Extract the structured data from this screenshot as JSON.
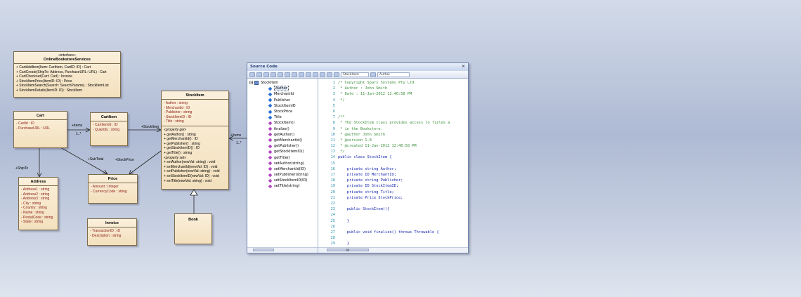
{
  "diagram": {
    "interface": {
      "stereotype": "«interface»",
      "name": "OnlineBookstoreServices",
      "ops": [
        "+  CartAddItem(Item: CartItem, CartID: ID)  : Cart",
        "+  CartCreate(ShipTo: Address, PurchaseURL: URL)  : Cart",
        "+  CartCheckout(Cart: Cart)  : Invoice",
        "+  StockItemPrice(ItemID: ID)  : Price",
        "+  StockItemSearch(Search: SearchParams)  : StockItemList",
        "+  StockItemDetails(ItemID: ID)  : StockItem"
      ]
    },
    "cart": {
      "name": "Cart",
      "attrs": [
        "-  CartId  : ID",
        "-  PurchaseURL  : URL"
      ]
    },
    "cartitem": {
      "name": "CartItem",
      "attrs": [
        "-  CartItemId  : ID",
        "-  Quantity  : string"
      ]
    },
    "stockitem": {
      "name": "StockItem",
      "attrs": [
        "-  Author  : string",
        "-  MerchantId  : ID",
        "-  Publisher  : string",
        "-  StockItemID  : ID",
        "-  Title  : string"
      ],
      "get_group": "«property get»",
      "gets": [
        "+  getAuthor()  : string",
        "+  getMerchantId()  : ID",
        "+  getPublisher()  : string",
        "+  getStockItemID()  : ID",
        "+  getTitle()  : string"
      ],
      "set_group": "«property set»",
      "sets": [
        "+  setAuthor(newVal: string)  : void",
        "+  setMerchantId(newVal: ID)  : void",
        "+  setPublisher(newVal: string)  : void",
        "+  setStockItemID(newVal: ID)  : void",
        "+  setTitle(newVal: string)  : void"
      ]
    },
    "address": {
      "name": "Address",
      "attrs": [
        "-  Address1  : string",
        "-  Address2  : string",
        "-  Address3  : string",
        "-  City  : string",
        "-  Country  : string",
        "-  Name  : string",
        "-  PostalCode  : string",
        "-  State  : string"
      ]
    },
    "price": {
      "name": "Price",
      "attrs": [
        "-  Amount  : Integer",
        "-  CurrencyCode  : string"
      ]
    },
    "invoice": {
      "name": "Invoice",
      "attrs": [
        "-  TransactionID  : ID",
        "-  Description  : string"
      ]
    },
    "book": {
      "name": "Book"
    },
    "labels": {
      "items1": "+Items",
      "mult1": "1..*",
      "stockitem": "+StockItem",
      "items2": "+Items",
      "mult2": "1..*",
      "subtotal": "+SubTotal",
      "stockprice": "+StockPrice",
      "shipto": "+ShipTo"
    }
  },
  "source_window": {
    "title": "Source Code",
    "close": "×",
    "toolbar_field_1": "StockItem",
    "toolbar_field_2": "Author",
    "tree": {
      "root": "StockItem",
      "items": [
        {
          "label": "Author",
          "kind": "attr"
        },
        {
          "label": "MerchantId",
          "kind": "attr"
        },
        {
          "label": "Publisher",
          "kind": "attr"
        },
        {
          "label": "StockItemID",
          "kind": "attr"
        },
        {
          "label": "StockPrice",
          "kind": "attr"
        },
        {
          "label": "Title",
          "kind": "attr"
        },
        {
          "label": "StockItem()",
          "kind": "op"
        },
        {
          "label": "finalize()",
          "kind": "op"
        },
        {
          "label": "getAuthor()",
          "kind": "op"
        },
        {
          "label": "getMerchantId()",
          "kind": "op"
        },
        {
          "label": "getPublisher()",
          "kind": "op"
        },
        {
          "label": "getStockItemID()",
          "kind": "op"
        },
        {
          "label": "getTitle()",
          "kind": "op"
        },
        {
          "label": "setAuthor(string)",
          "kind": "op"
        },
        {
          "label": "setMerchantId(ID)",
          "kind": "op"
        },
        {
          "label": "setPublisher(string)",
          "kind": "op"
        },
        {
          "label": "setStockItemID(ID)",
          "kind": "op"
        },
        {
          "label": "setTitle(string)",
          "kind": "op"
        }
      ]
    },
    "code": [
      {
        "n": "1",
        "t": "/* Copyright Sparx Systems Pty Ltd",
        "c": "comment"
      },
      {
        "n": "2",
        "t": " * Author : John Smith",
        "c": "comment"
      },
      {
        "n": "3",
        "t": " * Date : 11-Jan-2012 12:40:58 PM",
        "c": "comment"
      },
      {
        "n": "4",
        "t": " */",
        "c": "comment"
      },
      {
        "n": "5",
        "t": "",
        "c": ""
      },
      {
        "n": "6",
        "t": "",
        "c": ""
      },
      {
        "n": "7",
        "t": "/**",
        "c": "comment"
      },
      {
        "n": "8",
        "t": " * The StockItem class provides access to fields a",
        "c": "comment"
      },
      {
        "n": "9",
        "t": " * in the Bookstore.",
        "c": "comment"
      },
      {
        "n": "10",
        "t": " * @author John Smith",
        "c": "comment"
      },
      {
        "n": "11",
        "t": " * @version 1.0",
        "c": "comment"
      },
      {
        "n": "12",
        "t": " * @created 11-Jan-2012 12:40:58 PM",
        "c": "comment"
      },
      {
        "n": "13",
        "t": " */",
        "c": "comment"
      },
      {
        "n": "14",
        "t": "public class StockItem {",
        "c": "kw"
      },
      {
        "n": "15",
        "t": "",
        "c": ""
      },
      {
        "n": "16",
        "t": "    private string Author;",
        "c": "kw"
      },
      {
        "n": "17",
        "t": "    private ID MerchantId;",
        "c": "kw"
      },
      {
        "n": "18",
        "t": "    private string Publisher;",
        "c": "kw"
      },
      {
        "n": "19",
        "t": "    private ID StockItemID;",
        "c": "kw"
      },
      {
        "n": "20",
        "t": "    private string Title;",
        "c": "kw"
      },
      {
        "n": "21",
        "t": "    private Price StockPrice;",
        "c": "kw"
      },
      {
        "n": "22",
        "t": "",
        "c": ""
      },
      {
        "n": "23",
        "t": "    public StockItem(){",
        "c": "kw"
      },
      {
        "n": "24",
        "t": "",
        "c": ""
      },
      {
        "n": "25",
        "t": "    }",
        "c": "kw"
      },
      {
        "n": "26",
        "t": "",
        "c": ""
      },
      {
        "n": "27",
        "t": "    public void finalize() throws Throwable {",
        "c": "kw"
      },
      {
        "n": "28",
        "t": "",
        "c": ""
      },
      {
        "n": "29",
        "t": "    }",
        "c": "kw"
      },
      {
        "n": "30",
        "t": "    public string getAuthor(){",
        "c": "kw"
      }
    ],
    "scroll_marker": "III"
  },
  "colors": {
    "class_fill": "#f6e6c6",
    "class_border": "#7d6a4a",
    "attr_text": "#8a1a10",
    "comment": "#3c8f3c",
    "keyword": "#0b1da8",
    "line_number": "#2b91af"
  }
}
